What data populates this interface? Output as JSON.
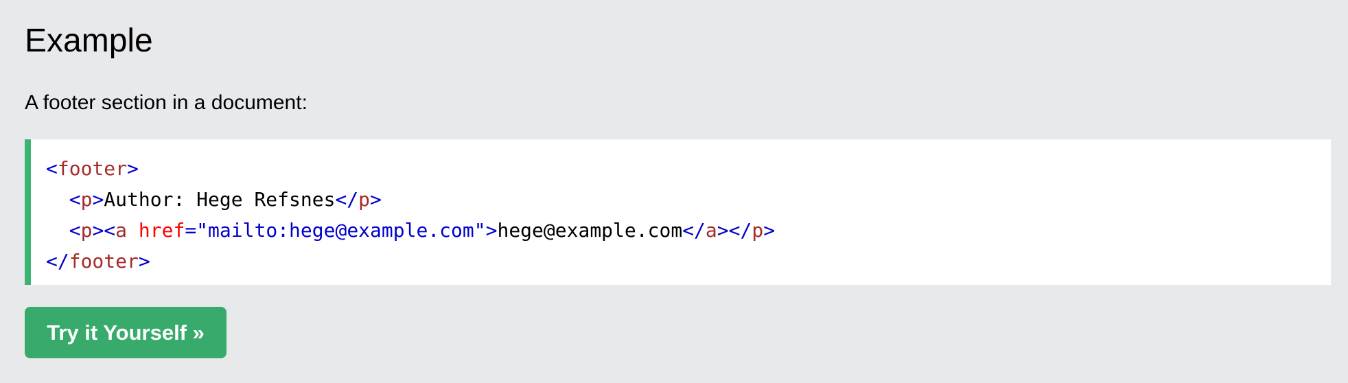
{
  "heading": "Example",
  "description": "A footer section in a document:",
  "code": {
    "line1": {
      "indent": "",
      "open_bracket": "<",
      "tag": "footer",
      "close_bracket": ">"
    },
    "line2": {
      "indent": "  ",
      "p_open_lt": "<",
      "p_tag": "p",
      "p_open_gt": ">",
      "text": "Author: Hege Refsnes",
      "p_close_lt": "</",
      "p_close_tag": "p",
      "p_close_gt": ">"
    },
    "line3": {
      "indent": "  ",
      "p_open_lt": "<",
      "p_tag": "p",
      "p_open_gt": ">",
      "a_open_lt": "<",
      "a_tag": "a",
      "space": " ",
      "attr_name": "href",
      "attr_eq": "=",
      "attr_value": "\"mailto:hege@example.com\"",
      "a_open_gt": ">",
      "link_text": "hege@example.com",
      "a_close_lt": "</",
      "a_close_tag": "a",
      "a_close_gt": ">",
      "p_close_lt": "</",
      "p_close_tag": "p",
      "p_close_gt": ">"
    },
    "line4": {
      "close_lt": "</",
      "tag": "footer",
      "close_gt": ">"
    }
  },
  "button": {
    "label": "Try it Yourself »"
  },
  "colors": {
    "background": "#e7e9eb",
    "code_border": "#3cb371",
    "button_bg": "#38ab6c",
    "tag_bracket": "mediumblue",
    "tag_name": "brown",
    "attr_name": "red",
    "attr_value": "mediumblue"
  }
}
